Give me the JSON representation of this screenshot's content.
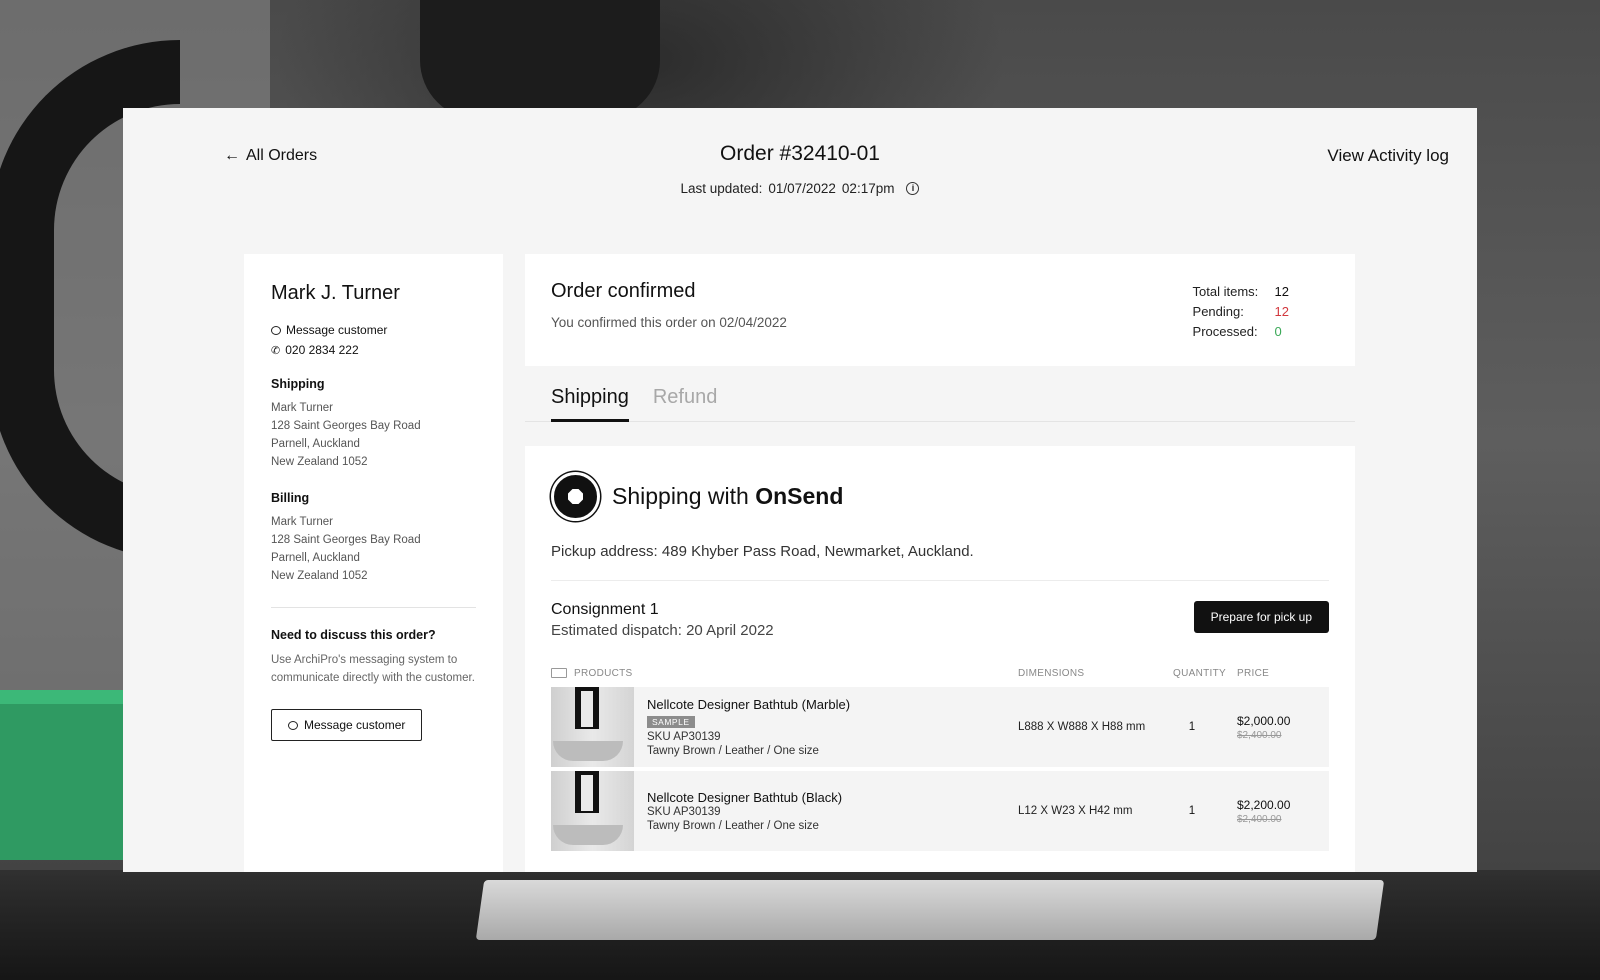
{
  "header": {
    "back_label": "All Orders",
    "order_title": "Order #32410-01",
    "last_updated_label": "Last updated:",
    "last_updated_date": "01/07/2022",
    "last_updated_time": "02:17pm",
    "activity_label": "View Activity log"
  },
  "customer": {
    "name": "Mark J. Turner",
    "message_label": "Message customer",
    "phone": "020 2834 222",
    "shipping_label": "Shipping",
    "shipping_address": [
      "Mark Turner",
      "128 Saint Georges Bay Road",
      "Parnell, Auckland",
      "New Zealand 1052"
    ],
    "billing_label": "Billing",
    "billing_address": [
      "Mark Turner",
      "128 Saint Georges Bay Road",
      "Parnell, Auckland",
      "New Zealand 1052"
    ],
    "discuss_title": "Need to discuss this order?",
    "discuss_text": "Use ArchiPro's messaging system to communicate directly with the customer.",
    "message_button": "Message customer"
  },
  "status": {
    "title": "Order confirmed",
    "subtitle": "You confirmed this order on 02/04/2022",
    "total_label": "Total items:",
    "total_value": "12",
    "pending_label": "Pending:",
    "pending_value": "12",
    "processed_label": "Processed:",
    "processed_value": "0",
    "colors": {
      "pending": "#d2383e",
      "processed": "#3aa857"
    }
  },
  "tabs": [
    {
      "label": "Shipping",
      "active": true
    },
    {
      "label": "Refund",
      "active": false
    }
  ],
  "shipping": {
    "prefix": "Shipping with",
    "provider": "OnSend",
    "pickup": "Pickup address: 489 Khyber Pass Road, Newmarket, Auckland.",
    "consignment_title": "Consignment 1",
    "consignment_dispatch": "Estimated dispatch: 20 April 2022",
    "prepare_button": "Prepare for pick up",
    "columns": {
      "products": "PRODUCTS",
      "dimensions": "DIMENSIONS",
      "quantity": "QUANTITY",
      "price": "PRICE"
    },
    "products": [
      {
        "name": "Nellcote Designer Bathtub (Marble)",
        "badge": "SAMPLE",
        "sku": "SKU AP30139",
        "variant": "Tawny Brown / Leather / One size",
        "dimensions": "L888 X W888 X H88 mm",
        "quantity": "1",
        "price": "$2,000.00",
        "old_price": "$2,400.00"
      },
      {
        "name": "Nellcote Designer Bathtub (Black)",
        "sku": "SKU AP30139",
        "variant": "Tawny Brown / Leather / One size",
        "dimensions": "L12 X W23 X H42 mm",
        "quantity": "1",
        "price": "$2,200.00",
        "old_price": "$2,400.00"
      }
    ]
  }
}
